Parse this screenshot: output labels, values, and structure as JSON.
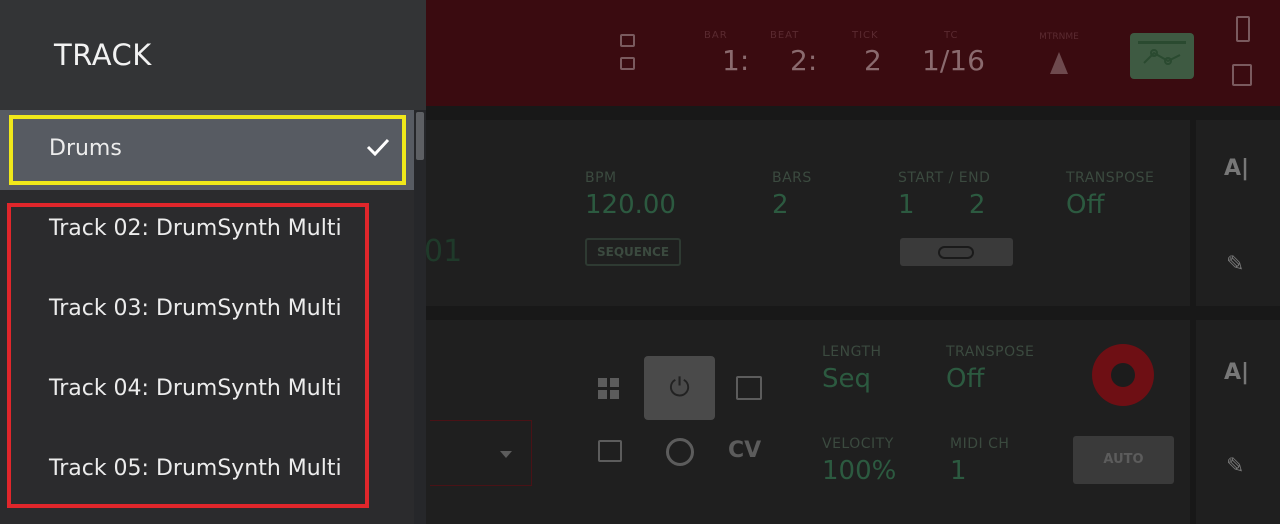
{
  "track_popup": {
    "title": "TRACK",
    "items": [
      {
        "label": "Drums",
        "selected": true
      },
      {
        "label": "Track 02: DrumSynth Multi",
        "selected": false
      },
      {
        "label": "Track 03: DrumSynth Multi",
        "selected": false
      },
      {
        "label": "Track 04: DrumSynth Multi",
        "selected": false
      },
      {
        "label": "Track 05: DrumSynth Multi",
        "selected": false
      }
    ],
    "check_icon": "checkmark-icon"
  },
  "background": {
    "topbar": {
      "bar": "BAR",
      "beat": "BEAT",
      "tick": "TICK",
      "tc": "TC",
      "bar_value": "1:",
      "beat_value": "2:",
      "tick_value": "2",
      "tc_value": "1/16",
      "metronome": "MTRNME"
    },
    "sequence": {
      "bpm_label": "BPM",
      "bpm_value": "120.00",
      "bars_label": "BARS",
      "bars_value": "2",
      "start_end_label": "START / END",
      "start_value": "1",
      "end_value": "2",
      "transpose_label": "TRANSPOSE",
      "transpose_value": "Off",
      "sequence_badge": "SEQUENCE",
      "ghost_number": "01"
    },
    "track": {
      "length_label": "LENGTH",
      "length_value": "Seq",
      "transpose_label": "TRANSPOSE",
      "transpose_value": "Off",
      "velocity_label": "VELOCITY",
      "velocity_value": "100%",
      "midi_ch_label": "MIDI CH",
      "midi_ch_value": "1",
      "auto_label": "AUTO",
      "cv_label": "CV"
    }
  },
  "colors": {
    "highlight_selected": "#f0e81a",
    "highlight_list": "#e0262b",
    "selected_row": "#575b62"
  }
}
